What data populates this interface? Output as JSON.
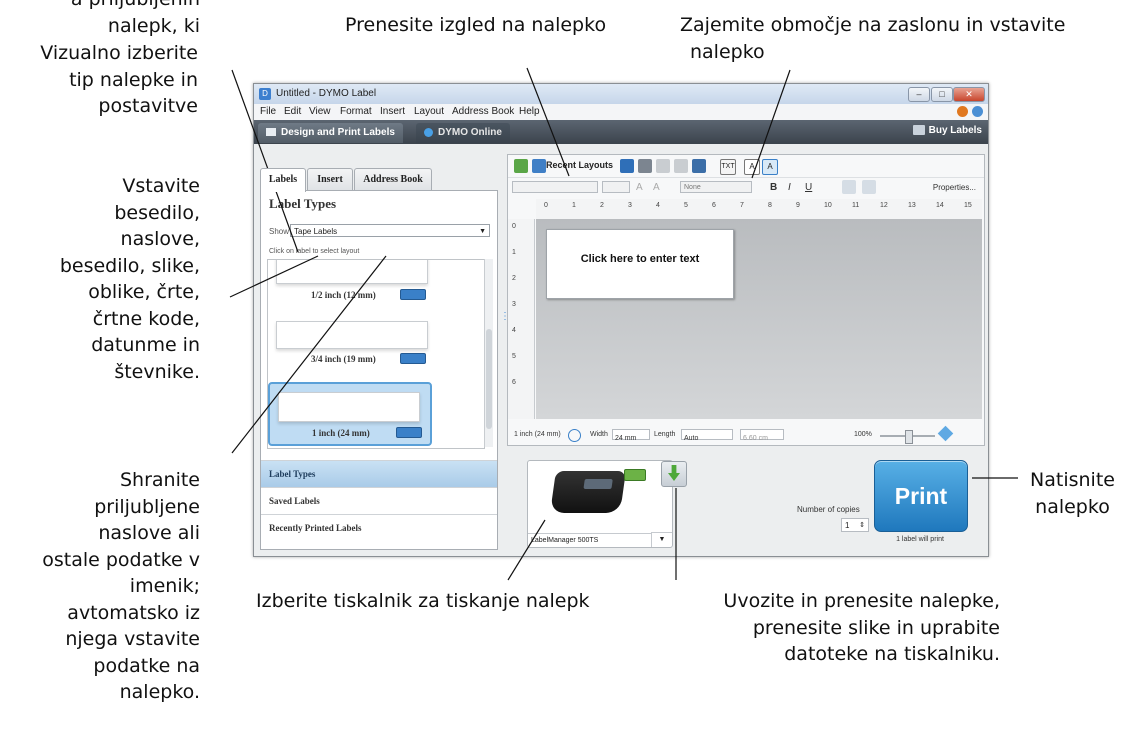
{
  "callouts": {
    "cut_top_left": "a priljubljenih nalepk, ki",
    "label_type": [
      "Vizualno izberite",
      "tip nalepke in",
      "postavitve"
    ],
    "apply_layout": "Prenesite izgled na nalepko",
    "capture": [
      "Zajemite območje na zaslonu in vstavite",
      "nalepko"
    ],
    "insert": [
      "Vstavite",
      "besedilo,",
      "naslove,",
      "besedilo, slike,",
      "oblike, črte,",
      "črtne kode,",
      "datunme in",
      "števnike."
    ],
    "address_book": [
      "Shranite",
      "priljubljene",
      "naslove  ali",
      "ostale podatke v",
      "imenik;",
      "avtomatsko iz",
      "njega vstavite",
      "podatke na",
      "nalepko."
    ],
    "print": [
      "Natisnite",
      "nalepko"
    ],
    "printer": "Izberite tiskalnik za tiskanje nalepk",
    "transfer": [
      "Uvozite in prenesite nalepke,",
      "prenesite slike in uprabite",
      "datoteke na tiskalniku."
    ]
  },
  "window": {
    "title": "Untitled - DYMO Label",
    "controls": {
      "minimize": "–",
      "maximize": "□",
      "close": "✕"
    }
  },
  "menu": [
    "File",
    "Edit",
    "View",
    "Format",
    "Insert",
    "Layout",
    "Address Book",
    "Help"
  ],
  "mode_tabs": {
    "design": "Design and Print Labels",
    "online": "DYMO Online",
    "buy": "Buy Labels"
  },
  "left": {
    "tabs": [
      "Labels",
      "Insert",
      "Address Book"
    ],
    "title": "Label Types",
    "show_label": "Show",
    "show_value": "Tape Labels",
    "hint": "Click on label to select layout",
    "labels": [
      "1/2 inch (12 mm)",
      "3/4 inch (19 mm)",
      "1 inch (24 mm)"
    ],
    "nav": [
      "Label Types",
      "Saved Labels",
      "Recently Printed Labels"
    ]
  },
  "editor": {
    "recent_layouts": "Recent Layouts",
    "font_size_value": "None",
    "bold": "B",
    "italic": "I",
    "underline": "U",
    "properties": "Properties...",
    "ruler": [
      "0",
      "1",
      "2",
      "3",
      "4",
      "5",
      "6",
      "7",
      "8",
      "9",
      "10",
      "11",
      "12",
      "13",
      "14",
      "15"
    ],
    "vruler": [
      "0",
      "1",
      "2",
      "3",
      "4",
      "5",
      "6"
    ],
    "canvas_text": "Click here to enter text",
    "status": {
      "tape": "1 inch (24 mm)",
      "width_label": "Width",
      "width_value": "24 mm",
      "length_label": "Length",
      "length_value": "Auto",
      "length_mm": "6.60 cm",
      "zoom": "100%"
    }
  },
  "bottom": {
    "printer_name": "LabelManager 500TS",
    "copies_label": "Number of copies",
    "copies_value": "1",
    "print": "Print",
    "will_print": "1 label will print"
  },
  "colors": {
    "accent": "#2a86cc",
    "modebar": "#48515b",
    "print_button": "#2f8ed4"
  }
}
